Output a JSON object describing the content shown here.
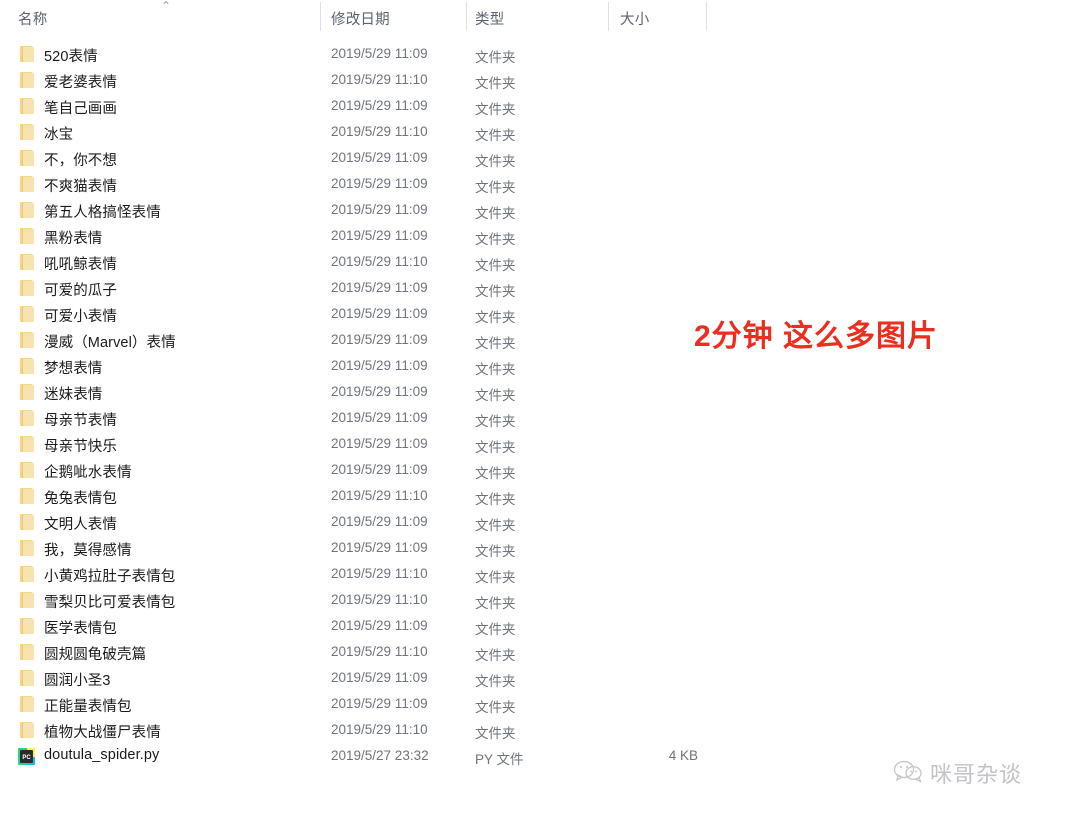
{
  "window": {
    "kind": "file-explorer-list-view"
  },
  "columns": {
    "name": "名称",
    "date_modified": "修改日期",
    "type": "类型",
    "size": "大小",
    "sort_indicator": "⌃",
    "sort_column": "名称",
    "sort_direction": "ascending"
  },
  "rows": [
    {
      "icon": "folder-icon",
      "name": "520表情",
      "date": "2019/5/29 11:09",
      "type": "文件夹",
      "size": ""
    },
    {
      "icon": "folder-icon",
      "name": "爱老婆表情",
      "date": "2019/5/29 11:10",
      "type": "文件夹",
      "size": ""
    },
    {
      "icon": "folder-icon",
      "name": "笔自己画画",
      "date": "2019/5/29 11:09",
      "type": "文件夹",
      "size": ""
    },
    {
      "icon": "folder-icon",
      "name": "冰宝",
      "date": "2019/5/29 11:10",
      "type": "文件夹",
      "size": ""
    },
    {
      "icon": "folder-icon",
      "name": "不，你不想",
      "date": "2019/5/29 11:09",
      "type": "文件夹",
      "size": ""
    },
    {
      "icon": "folder-icon",
      "name": "不爽猫表情",
      "date": "2019/5/29 11:09",
      "type": "文件夹",
      "size": ""
    },
    {
      "icon": "folder-icon",
      "name": "第五人格搞怪表情",
      "date": "2019/5/29 11:09",
      "type": "文件夹",
      "size": ""
    },
    {
      "icon": "folder-icon",
      "name": "黑粉表情",
      "date": "2019/5/29 11:09",
      "type": "文件夹",
      "size": ""
    },
    {
      "icon": "folder-icon",
      "name": "吼吼鲸表情",
      "date": "2019/5/29 11:10",
      "type": "文件夹",
      "size": ""
    },
    {
      "icon": "folder-icon",
      "name": "可爱的瓜子",
      "date": "2019/5/29 11:09",
      "type": "文件夹",
      "size": ""
    },
    {
      "icon": "folder-icon",
      "name": "可爱小表情",
      "date": "2019/5/29 11:09",
      "type": "文件夹",
      "size": ""
    },
    {
      "icon": "folder-icon",
      "name": "漫威（Marvel）表情",
      "date": "2019/5/29 11:09",
      "type": "文件夹",
      "size": ""
    },
    {
      "icon": "folder-icon",
      "name": "梦想表情",
      "date": "2019/5/29 11:09",
      "type": "文件夹",
      "size": ""
    },
    {
      "icon": "folder-icon",
      "name": "迷妹表情",
      "date": "2019/5/29 11:09",
      "type": "文件夹",
      "size": ""
    },
    {
      "icon": "folder-icon",
      "name": "母亲节表情",
      "date": "2019/5/29 11:09",
      "type": "文件夹",
      "size": ""
    },
    {
      "icon": "folder-icon",
      "name": "母亲节快乐",
      "date": "2019/5/29 11:09",
      "type": "文件夹",
      "size": ""
    },
    {
      "icon": "folder-icon",
      "name": "企鹅呲水表情",
      "date": "2019/5/29 11:09",
      "type": "文件夹",
      "size": ""
    },
    {
      "icon": "folder-icon",
      "name": "兔兔表情包",
      "date": "2019/5/29 11:10",
      "type": "文件夹",
      "size": ""
    },
    {
      "icon": "folder-icon",
      "name": "文明人表情",
      "date": "2019/5/29 11:09",
      "type": "文件夹",
      "size": ""
    },
    {
      "icon": "folder-icon",
      "name": "我，莫得感情",
      "date": "2019/5/29 11:09",
      "type": "文件夹",
      "size": ""
    },
    {
      "icon": "folder-icon",
      "name": "小黄鸡拉肚子表情包",
      "date": "2019/5/29 11:10",
      "type": "文件夹",
      "size": ""
    },
    {
      "icon": "folder-icon",
      "name": "雪梨贝比可爱表情包",
      "date": "2019/5/29 11:10",
      "type": "文件夹",
      "size": ""
    },
    {
      "icon": "folder-icon",
      "name": "医学表情包",
      "date": "2019/5/29 11:09",
      "type": "文件夹",
      "size": ""
    },
    {
      "icon": "folder-icon",
      "name": "圆规圆龟破壳篇",
      "date": "2019/5/29 11:10",
      "type": "文件夹",
      "size": ""
    },
    {
      "icon": "folder-icon",
      "name": "圆润小圣3",
      "date": "2019/5/29 11:09",
      "type": "文件夹",
      "size": ""
    },
    {
      "icon": "folder-icon",
      "name": "正能量表情包",
      "date": "2019/5/29 11:09",
      "type": "文件夹",
      "size": ""
    },
    {
      "icon": "folder-icon",
      "name": "植物大战僵尸表情",
      "date": "2019/5/29 11:10",
      "type": "文件夹",
      "size": ""
    },
    {
      "icon": "pycharm-file-icon",
      "name": "doutula_spider.py",
      "date": "2019/5/27 23:32",
      "type": "PY 文件",
      "size": "4 KB"
    }
  ],
  "annotation": {
    "text": "2分钟 这么多图片",
    "color": "#ec2d1f"
  },
  "watermark": {
    "icon": "wechat-logo-icon",
    "text": "咪哥杂谈"
  }
}
